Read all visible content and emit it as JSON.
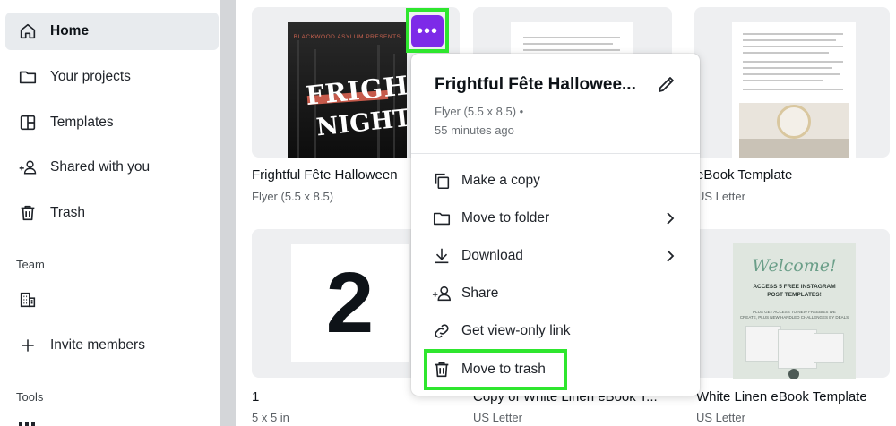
{
  "sidebar": {
    "items": [
      {
        "label": "Home",
        "icon": "home-icon",
        "active": true
      },
      {
        "label": "Your projects",
        "icon": "folder-icon"
      },
      {
        "label": "Templates",
        "icon": "templates-icon"
      },
      {
        "label": "Shared with you",
        "icon": "people-icon"
      },
      {
        "label": "Trash",
        "icon": "trash-icon"
      }
    ],
    "team_label": "Team",
    "team_icon": "building-icon",
    "invite_label": "Invite members",
    "tools_label": "Tools"
  },
  "cards": [
    {
      "title": "Frightful Fête Halloween",
      "subtitle": "Flyer (5.5 x 8.5)",
      "thumb": {
        "header": "BLACKWOOD ASYLUM PRESENTS",
        "line1": "FRIGHT",
        "line2": "NIGHT"
      }
    },
    {
      "title": "eBook Template",
      "subtitle": "US Letter"
    },
    {
      "title": "1",
      "subtitle": "5 x 5 in",
      "thumb_number": "2"
    },
    {
      "title": "Copy of White Linen eBook T...",
      "subtitle": "US Letter"
    },
    {
      "title": "White Linen eBook Template",
      "subtitle": "US Letter",
      "thumb": {
        "heading": "Welcome!",
        "line1": "ACCESS 5 FREE INSTAGRAM",
        "line2": "POST TEMPLATES!",
        "fine1": "PLUS GET ACCESS TO NEW FREEBIES WE",
        "fine2": "CREATE, PLUS NEW HANDLED CHALLENGES BY DEALS"
      }
    }
  ],
  "more_button": {
    "label": "•••"
  },
  "menu": {
    "title": "Frightful Fête Hallowee...",
    "meta_type": "Flyer (5.5 x 8.5) •",
    "meta_time": "55 minutes ago",
    "items": [
      {
        "label": "Make a copy",
        "icon": "copy-icon"
      },
      {
        "label": "Move to folder",
        "icon": "folder-icon",
        "submenu": true
      },
      {
        "label": "Download",
        "icon": "download-icon",
        "submenu": true
      },
      {
        "label": "Share",
        "icon": "share-people-icon"
      },
      {
        "label": "Get view-only link",
        "icon": "link-icon"
      },
      {
        "label": "Move to trash",
        "icon": "trash-icon"
      }
    ]
  },
  "colors": {
    "accent": "#7d2ae8",
    "highlight": "#2ee62e",
    "sidebar_active": "#e8ebee"
  }
}
